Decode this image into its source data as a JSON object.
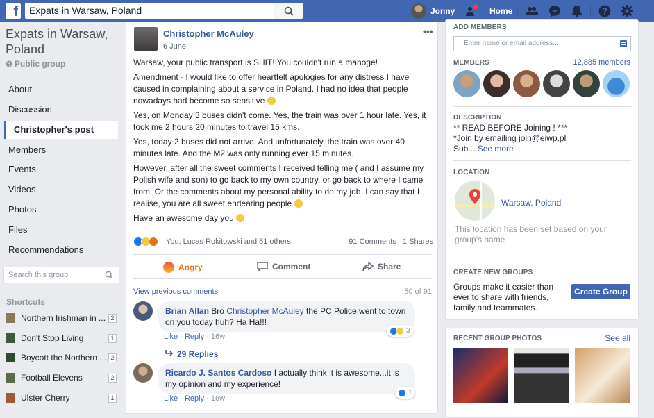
{
  "topbar": {
    "search_value": "Expats in Warsaw, Poland",
    "user_name": "Jonny",
    "home_label": "Home"
  },
  "left": {
    "group_title": "Expats in Warsaw, Poland",
    "group_type": "Public group",
    "nav": [
      "About",
      "Discussion",
      "Christopher's post",
      "Members",
      "Events",
      "Videos",
      "Photos",
      "Files",
      "Recommendations"
    ],
    "search_placeholder": "Search this group",
    "shortcuts_title": "Shortcuts",
    "shortcuts": [
      {
        "label": "Northern Irishman in ...",
        "count": "2"
      },
      {
        "label": "Don't Stop Living",
        "count": "1"
      },
      {
        "label": "Boycott the Northern ...",
        "count": "2"
      },
      {
        "label": "Football Elevens",
        "count": "2"
      },
      {
        "label": "Ulster Cherry",
        "count": "1"
      }
    ]
  },
  "post": {
    "author": "Christopher McAuley",
    "date": "6 June",
    "paragraphs": [
      "Warsaw, your public transport is SHIT! You couldn't run a manoge!",
      "Amendment - I would like to offer heartfelt apologies for any distress I have caused in complaining about a service in Poland. I had no idea that people nowadays had become so sensitive",
      "Yes, on Monday 3 buses didn't come. Yes, the train was over 1 hour late. Yes, it took me 2 hours 20 minutes to travel 15 kms.",
      "Yes, today 2 buses did not arrive. And unfortunately, the train was over 40 minutes late. And the M2 was only running ever 15 minutes.",
      "However, after all the sweet comments I received telling me ( and I assume my Polish wife and son) to go back to my own country, or go back to where I came from. Or the comments about my personal ability to do my job. I can say that I realise, you are all sweet endearing people",
      "Have an awesome day you"
    ],
    "reactions_text": "You, Lucas Rokitowski and 51 others",
    "comments_count": "91 Comments",
    "shares_count": "1 Shares",
    "actions": {
      "angry": "Angry",
      "comment": "Comment",
      "share": "Share"
    },
    "view_previous": "View previous comments",
    "comments_position": "50 of 91",
    "comments": [
      {
        "author": "Brian Allan",
        "text_prefix": "Bro",
        "mention": "Christopher McAuley",
        "text": "the PC Police went to town on you today huh? Ha Ha!!!",
        "like": "Like",
        "reply": "Reply",
        "time": "16w",
        "reaction_count": "3",
        "replies": "29 Replies"
      },
      {
        "author": "Ricardo J. Santos Cardoso",
        "text": "I actually think it is awesome...it is my opinion and my experience!",
        "like": "Like",
        "reply": "Reply",
        "time": "16w",
        "reaction_count": "1"
      }
    ]
  },
  "right": {
    "add_members_title": "Add Members",
    "add_members_placeholder": "Enter name or email address...",
    "members_title": "Members",
    "members_count": "12,885 members",
    "description_title": "Description",
    "description_lines": [
      "** READ BEFORE Joining ! ***",
      "*Join by emailing join@eiwp.pl",
      "Sub..."
    ],
    "see_more": "See more",
    "location_title": "Location",
    "location_name": "Warsaw, Poland",
    "location_note": "This location has been set based on your group's name",
    "create_title": "Create New Groups",
    "create_text": "Groups make it easier than ever to share with friends, family and teammates.",
    "create_button": "Create Group",
    "photos_title": "Recent Group Photos",
    "see_all": "See all"
  }
}
